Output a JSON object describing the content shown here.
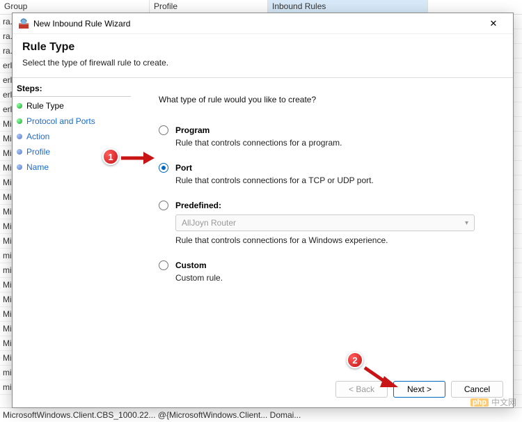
{
  "background": {
    "columns": {
      "group": "Group",
      "profile": "Profile",
      "inbound": "Inbound Rules"
    },
    "rows": [
      "ra.S",
      "ra.S",
      "ra.S",
      "erlı",
      "erlı",
      "erlı",
      "erlı",
      "Mic",
      "Mic",
      "Mic",
      "Mic",
      "Mic",
      "Mic",
      "Mic",
      "Mic",
      "Mic",
      "mic",
      "mic",
      "Mic",
      "Mic",
      "Mic",
      "Mic",
      "Mic",
      "Mic",
      "mic",
      "mic"
    ],
    "footer": "MicrosoftWindows.Client.CBS_1000.22...   @{MicrosoftWindows.Client...   Domai..."
  },
  "dialog": {
    "title": "New Inbound Rule Wizard",
    "close": "✕",
    "header": {
      "h1": "Rule Type",
      "p": "Select the type of firewall rule to create."
    },
    "steps": {
      "title": "Steps:",
      "items": [
        {
          "label": "Rule Type",
          "current": true
        },
        {
          "label": "Protocol and Ports",
          "current": false
        },
        {
          "label": "Action",
          "current": false
        },
        {
          "label": "Profile",
          "current": false
        },
        {
          "label": "Name",
          "current": false
        }
      ]
    },
    "prompt": "What type of rule would you like to create?",
    "options": {
      "program": {
        "label": "Program",
        "desc": "Rule that controls connections for a program."
      },
      "port": {
        "label": "Port",
        "desc": "Rule that controls connections for a TCP or UDP port."
      },
      "predef": {
        "label": "Predefined:",
        "value": "AllJoyn Router",
        "desc": "Rule that controls connections for a Windows experience."
      },
      "custom": {
        "label": "Custom",
        "desc": "Custom rule."
      }
    },
    "buttons": {
      "back": "< Back",
      "next": "Next >",
      "cancel": "Cancel"
    }
  },
  "annotations": {
    "one": "1",
    "two": "2"
  },
  "watermark": {
    "logo": "php",
    "text": "中文网"
  }
}
